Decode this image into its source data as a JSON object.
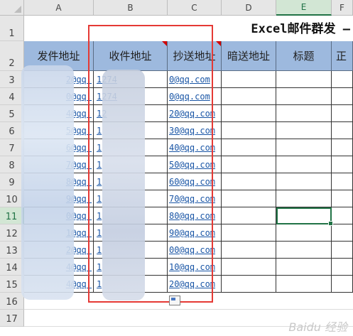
{
  "columns": [
    "A",
    "B",
    "C",
    "D",
    "E",
    "F"
  ],
  "rows": [
    "1",
    "2",
    "3",
    "4",
    "5",
    "6",
    "7",
    "8",
    "9",
    "10",
    "11",
    "12",
    "13",
    "14",
    "15",
    "16",
    "17"
  ],
  "active": {
    "column": "E",
    "row": "11"
  },
  "title": "Excel邮件群发 –",
  "headers": [
    "发件地址",
    "收件地址",
    "抄送地址",
    "暗送地址",
    "标题",
    "正"
  ],
  "sender": [
    "2@qq.",
    "0@qq.",
    "4@qq.",
    "5@qq.",
    "6@qq.",
    "7@qq.",
    "8@qq.",
    "9@qq.",
    "0@qq.",
    "1@qq.",
    "2@qq.",
    "4@qq.",
    "4@qq."
  ],
  "receiver": [
    "1274",
    "1274",
    "12",
    "1",
    "1",
    "1",
    "1",
    "1",
    "1",
    "1",
    "1",
    "1",
    "1"
  ],
  "cc": [
    "0@qq.com",
    "0@qq.com",
    "20@qq.com",
    "30@qq.com",
    "40@qq.com",
    "50@qq.com",
    "60@qq.com",
    "70@qq.com",
    "80@qq.com",
    "90@qq.com",
    "00@qq.com",
    "10@qq.com",
    "20@qq.com"
  ],
  "watermark": "Baidu 经验",
  "colors": {
    "header_bg": "#9db9de",
    "link": "#1a56a6",
    "selection": "#217346",
    "highlight_box": "#e53935"
  }
}
